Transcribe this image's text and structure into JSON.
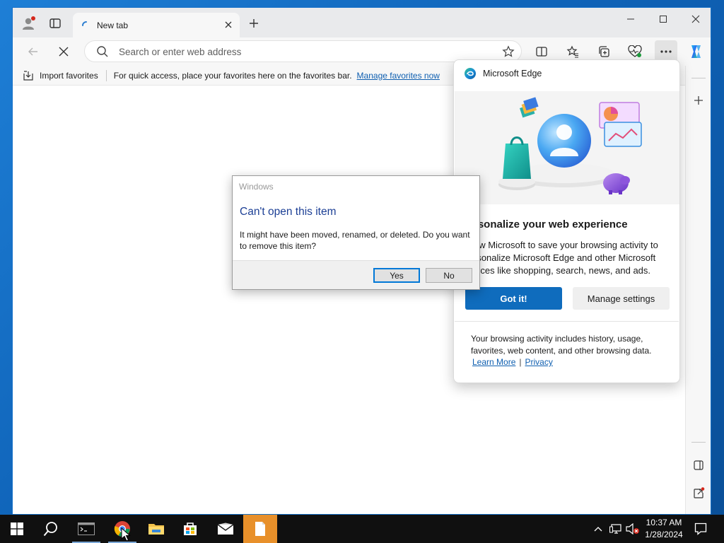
{
  "browser": {
    "tab": {
      "title": "New tab"
    },
    "omnibox": {
      "placeholder": "Search or enter web address"
    },
    "favorites_bar": {
      "import_label": "Import favorites",
      "hint": "For quick access, place your favorites here on the favorites bar.",
      "manage_link": "Manage favorites now"
    }
  },
  "flyout": {
    "app_name": "Microsoft Edge",
    "title": "rsonalize your web experience",
    "body": "ow Microsoft to save your browsing activity to rsonalize Microsoft Edge and other Microsoft vices like shopping, search, news, and ads.",
    "primary_button": "Got it!",
    "secondary_button": "Manage settings",
    "note": "Your browsing activity includes history, usage, favorites, web content, and other browsing data.",
    "learn_more": "Learn More",
    "separator": "|",
    "privacy": "Privacy"
  },
  "dialog": {
    "caption": "Windows",
    "heading": "Can't open this item",
    "message": "It might have been moved, renamed, or deleted. Do you want to remove this item?",
    "yes": "Yes",
    "no": "No"
  },
  "taskbar": {
    "time": "10:37 AM",
    "date": "1/28/2024"
  },
  "colors": {
    "accent": "#0f6cbd",
    "dialog_heading": "#1c3f95",
    "link": "#0f5fb0",
    "taskbar": "#101010",
    "active_taskbar_item": "#e8902a"
  }
}
